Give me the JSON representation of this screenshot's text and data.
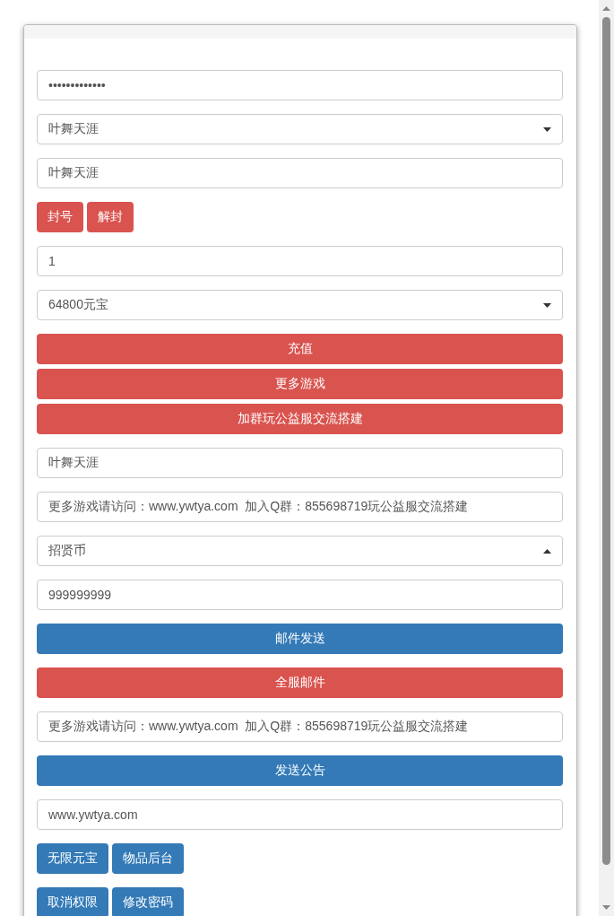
{
  "items": [
    {
      "kind": "input",
      "value": "•••••••••••••"
    },
    {
      "kind": "select",
      "value": "叶舞天涯",
      "expanded": false
    },
    {
      "kind": "input",
      "value": "叶舞天涯"
    },
    {
      "kind": "button_row",
      "buttons": [
        {
          "label": "封号",
          "color": "#d9534f"
        },
        {
          "label": "解封",
          "color": "#d9534f"
        }
      ]
    },
    {
      "kind": "input",
      "value": "1"
    },
    {
      "kind": "select",
      "value": "64800元宝",
      "expanded": false
    },
    {
      "kind": "button_stack",
      "buttons": [
        {
          "label": "充值",
          "color": "#d9534f"
        },
        {
          "label": "更多游戏",
          "color": "#d9534f"
        },
        {
          "label": "加群玩公益服交流搭建",
          "color": "#d9534f"
        }
      ]
    },
    {
      "kind": "input",
      "value": "叶舞天涯"
    },
    {
      "kind": "input",
      "value": "更多游戏请访问：www.ywtya.com  加入Q群：855698719玩公益服交流搭建"
    },
    {
      "kind": "select",
      "value": "招贤币",
      "expanded": true
    },
    {
      "kind": "input",
      "value": "999999999"
    },
    {
      "kind": "button_stack",
      "buttons": [
        {
          "label": "邮件发送",
          "color": "#337ab7"
        }
      ]
    },
    {
      "kind": "button_stack",
      "buttons": [
        {
          "label": "全服邮件",
          "color": "#d9534f"
        }
      ]
    },
    {
      "kind": "input",
      "value": "更多游戏请访问：www.ywtya.com  加入Q群：855698719玩公益服交流搭建"
    },
    {
      "kind": "button_stack",
      "buttons": [
        {
          "label": "发送公告",
          "color": "#337ab7"
        }
      ]
    },
    {
      "kind": "input",
      "value": "www.ywtya.com"
    },
    {
      "kind": "button_row",
      "buttons": [
        {
          "label": "无限元宝",
          "color": "#337ab7"
        },
        {
          "label": "物品后台",
          "color": "#337ab7"
        }
      ]
    },
    {
      "kind": "button_row",
      "buttons": [
        {
          "label": "取消权限",
          "color": "#337ab7"
        },
        {
          "label": "修改密码",
          "color": "#337ab7"
        }
      ]
    }
  ]
}
